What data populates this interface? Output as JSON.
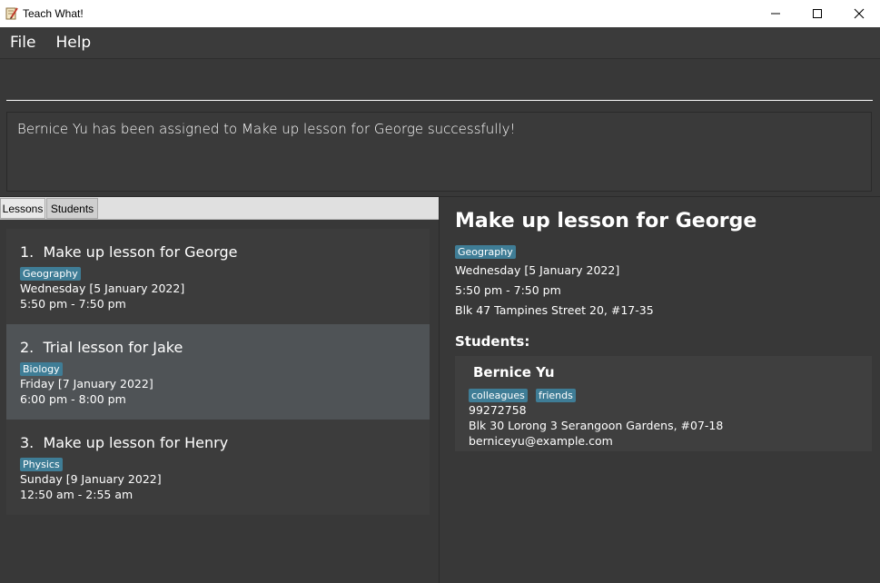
{
  "window": {
    "title": "Teach What!",
    "controls": [
      "minimize-icon",
      "maximize-icon",
      "close-icon"
    ]
  },
  "menu": {
    "file_label": "File",
    "help_label": "Help"
  },
  "command": {
    "value": "",
    "placeholder": ""
  },
  "result": {
    "message": "Bernice Yu has been assigned to Make up lesson for George successfully!"
  },
  "tabs": [
    {
      "label": "Lessons"
    },
    {
      "label": "Students"
    }
  ],
  "lessons": [
    {
      "index": "1.",
      "title": "Make up lesson for George",
      "subject": "Geography",
      "date": "Wednesday [5 January 2022]",
      "time": "5:50 pm - 7:50 pm"
    },
    {
      "index": "2.",
      "title": "Trial lesson for Jake",
      "subject": "Biology",
      "date": "Friday [7 January 2022]",
      "time": "6:00 pm - 8:00 pm"
    },
    {
      "index": "3.",
      "title": "Make up lesson for Henry",
      "subject": "Physics",
      "date": "Sunday [9 January 2022]",
      "time": "12:50 am - 2:55 am"
    }
  ],
  "detail": {
    "title": "Make up lesson for George",
    "subject": "Geography",
    "date": "Wednesday [5 January 2022]",
    "time": "5:50 pm - 7:50 pm",
    "address": "Blk 47 Tampines Street 20, #17-35",
    "students_heading": "Students:",
    "students": [
      {
        "name": "Bernice Yu",
        "tags": [
          "colleagues",
          "friends"
        ],
        "phone": "99272758",
        "address": "Blk 30 Lorong 3 Serangoon Gardens, #07-18",
        "email": "berniceyu@example.com"
      }
    ]
  },
  "colors": {
    "background": "#383838",
    "tag": "#3f7d96",
    "selected_card": "#4f5356"
  }
}
